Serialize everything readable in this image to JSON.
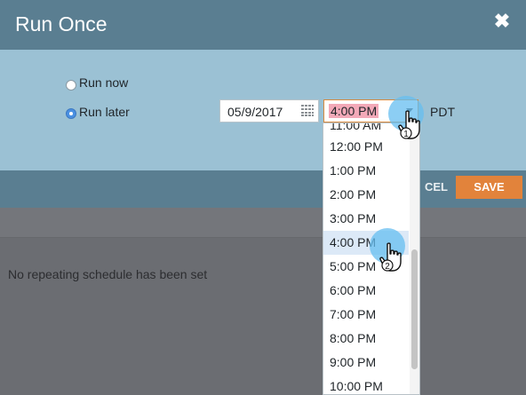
{
  "dialog": {
    "title": "Run Once",
    "close_glyph": "✖"
  },
  "options": {
    "run_now_label": "Run now",
    "run_later_label": "Run later",
    "selected": "run_later"
  },
  "schedule": {
    "date": "05/9/2017",
    "time": "4:00 PM",
    "timezone": "PDT"
  },
  "footer": {
    "cancel_label": "CEL",
    "save_label": "SAVE"
  },
  "background": {
    "message": "No repeating schedule has been set"
  },
  "time_dropdown": {
    "items": [
      "11:00 AM",
      "12:00 PM",
      "1:00 PM",
      "2:00 PM",
      "3:00 PM",
      "4:00 PM",
      "5:00 PM",
      "6:00 PM",
      "7:00 PM",
      "8:00 PM",
      "9:00 PM",
      "10:00 PM"
    ],
    "selected": "4:00 PM"
  },
  "annotations": {
    "step1": "1",
    "step2": "2"
  },
  "colors": {
    "header": "#5a7e91",
    "body": "#9bc1d4",
    "save": "#e2833b",
    "tap": "#66bef0"
  }
}
